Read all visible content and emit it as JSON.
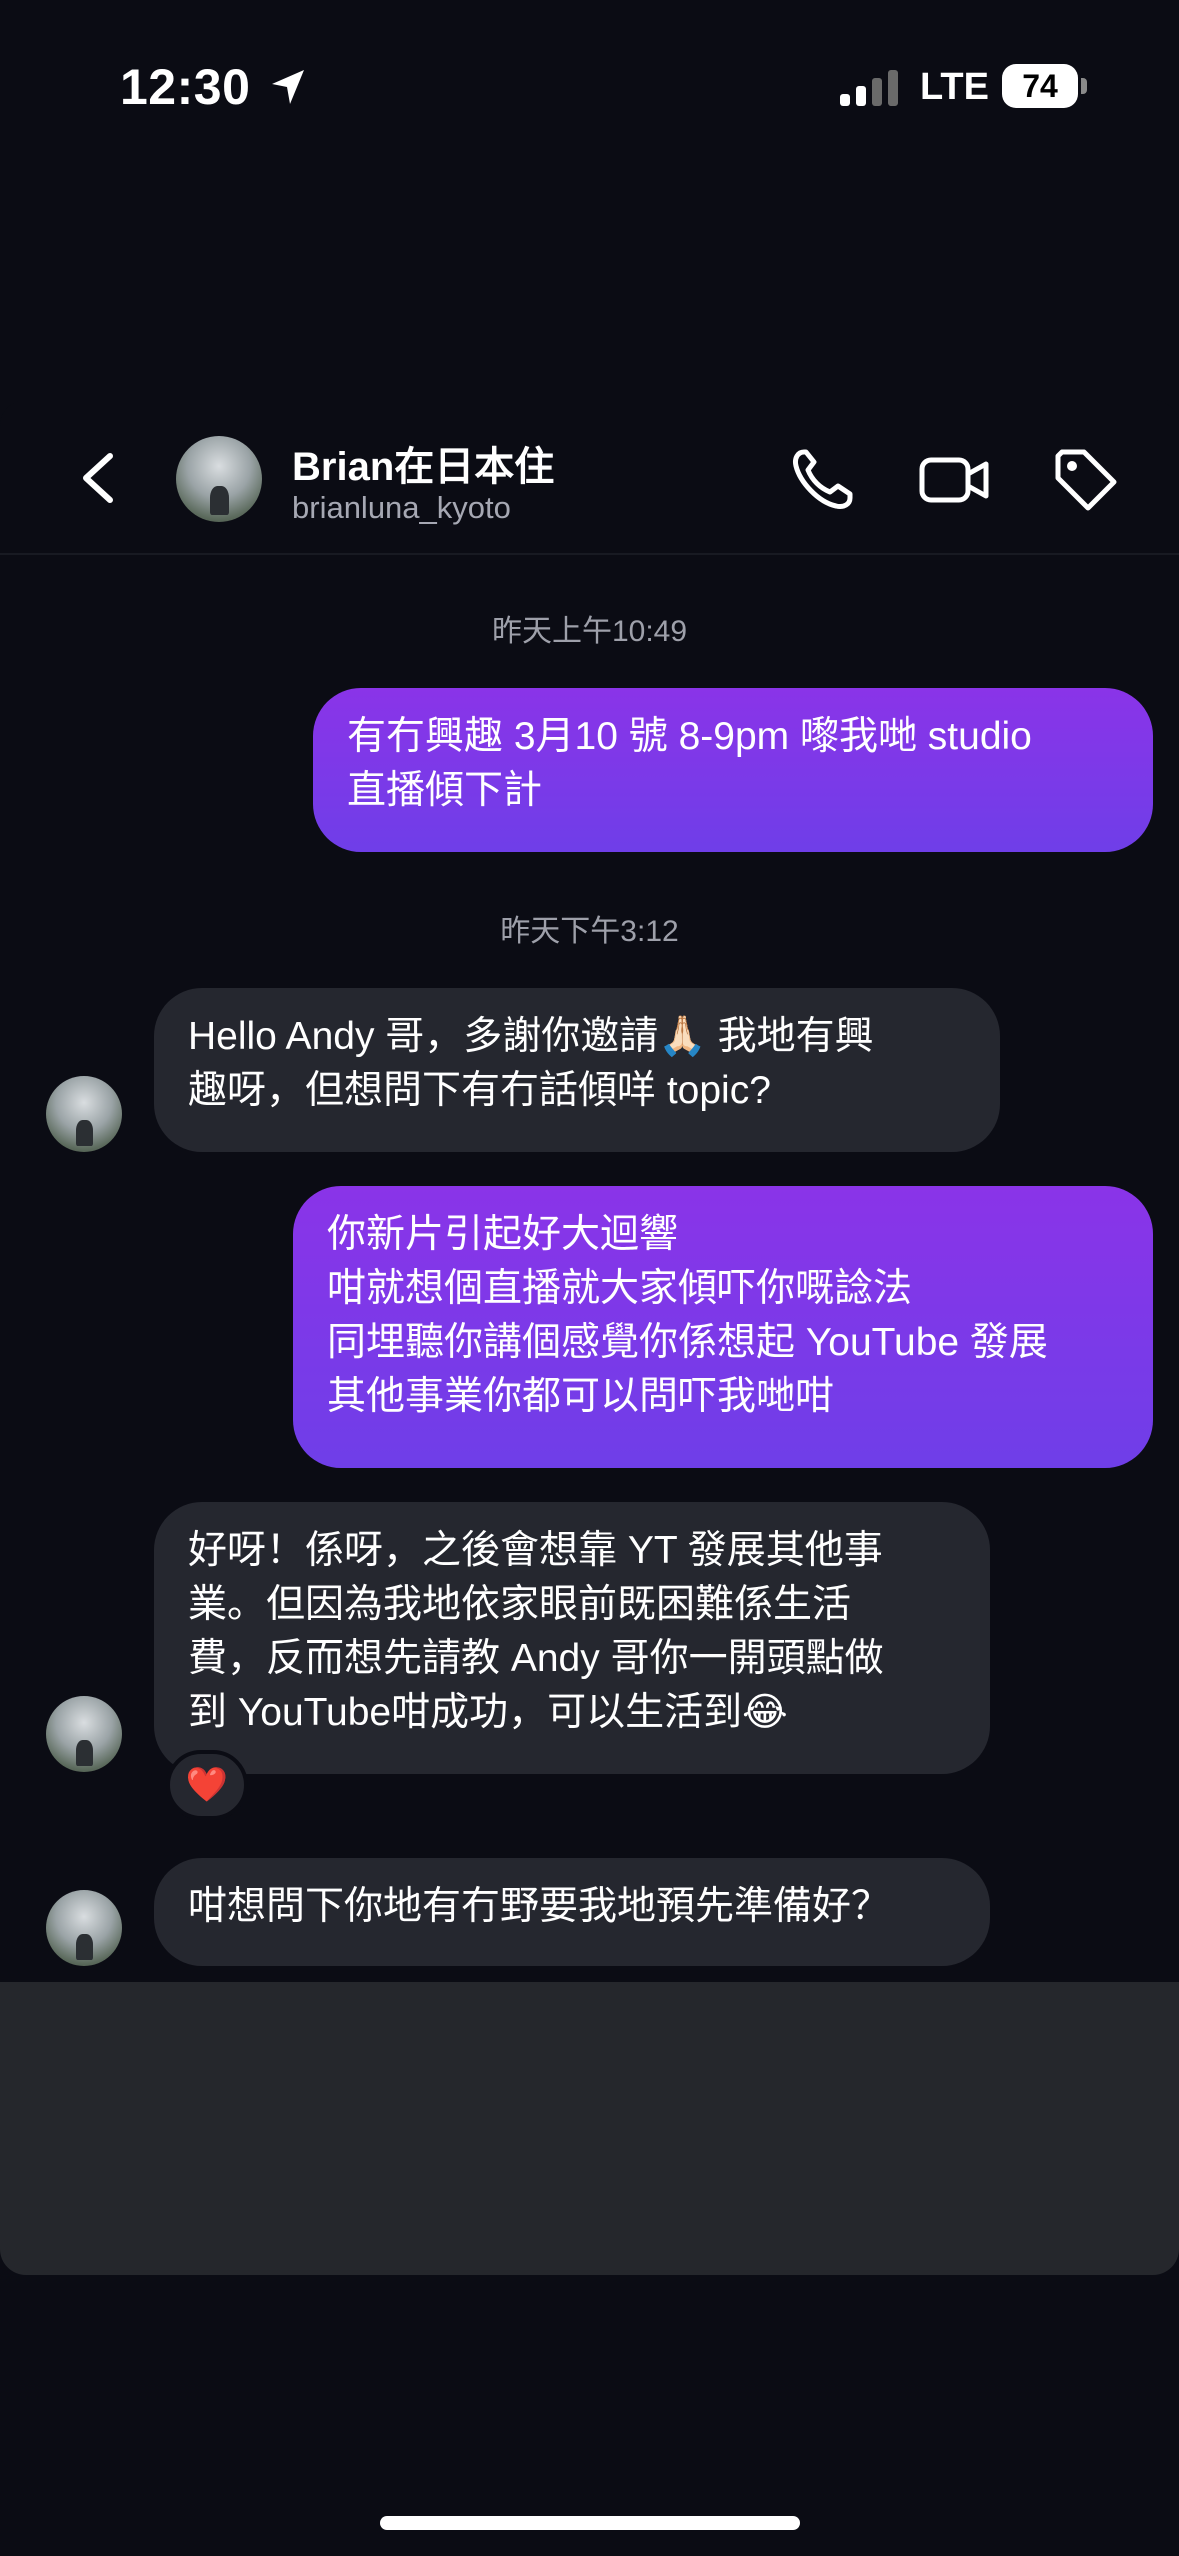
{
  "status_bar": {
    "time": "12:30",
    "network": "LTE",
    "battery": "74"
  },
  "header": {
    "contact_name": "Brian在日本住",
    "contact_handle": "brianluna_kyoto"
  },
  "messages": [
    {
      "type": "timestamp",
      "text": "昨天上午10:49"
    },
    {
      "type": "outgoing",
      "text": "有冇興趣 3月10 號 8-9pm 嚟我哋 studio\n直播傾下計"
    },
    {
      "type": "timestamp",
      "text": "昨天下午3:12"
    },
    {
      "type": "incoming",
      "text": "Hello Andy 哥，多謝你邀請🙏🏻 我地有興\n趣呀，但想問下有冇話傾咩 topic?"
    },
    {
      "type": "outgoing",
      "text": "你新片引起好大迴響\n咁就想個直播就大家傾吓你嘅諗法\n同埋聽你講個感覺你係想起 YouTube 發展\n其他事業你都可以問吓我哋咁"
    },
    {
      "type": "incoming",
      "text": "好呀！係呀，之後會想靠 YT 發展其他事\n業。但因為我地依家眼前既困難係生活\n費，反而想先請教 Andy 哥你一開頭點做\n到 YouTube咁成功，可以生活到😂",
      "reaction": "❤️"
    },
    {
      "type": "incoming",
      "text": "咁想問下你地有冇野要我地預先準備好？"
    }
  ],
  "colors": {
    "outgoing_bubble": "#7a38e8",
    "incoming_bubble": "#25272f",
    "background": "#0b0c14"
  }
}
